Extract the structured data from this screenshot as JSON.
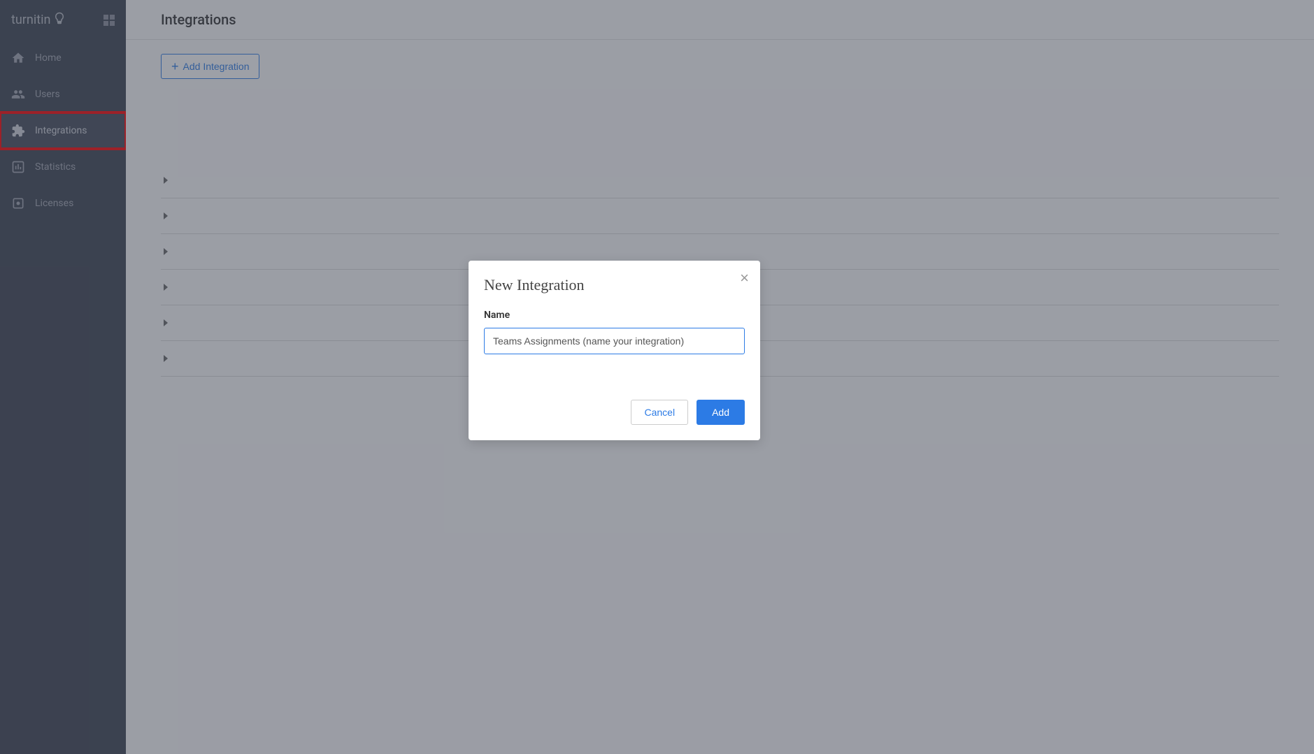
{
  "brand": "turnitin",
  "page_title": "Integrations",
  "sidebar": {
    "items": [
      {
        "label": "Home",
        "icon": "home-icon"
      },
      {
        "label": "Users",
        "icon": "users-icon"
      },
      {
        "label": "Integrations",
        "icon": "puzzle-icon",
        "active": true,
        "highlighted": true
      },
      {
        "label": "Statistics",
        "icon": "chart-icon"
      },
      {
        "label": "Licenses",
        "icon": "license-icon"
      }
    ]
  },
  "add_integration_button": "Add Integration",
  "integration_rows": 6,
  "modal": {
    "title": "New Integration",
    "name_label": "Name",
    "name_value": "Teams Assignments (name your integration)",
    "cancel_label": "Cancel",
    "add_label": "Add"
  }
}
